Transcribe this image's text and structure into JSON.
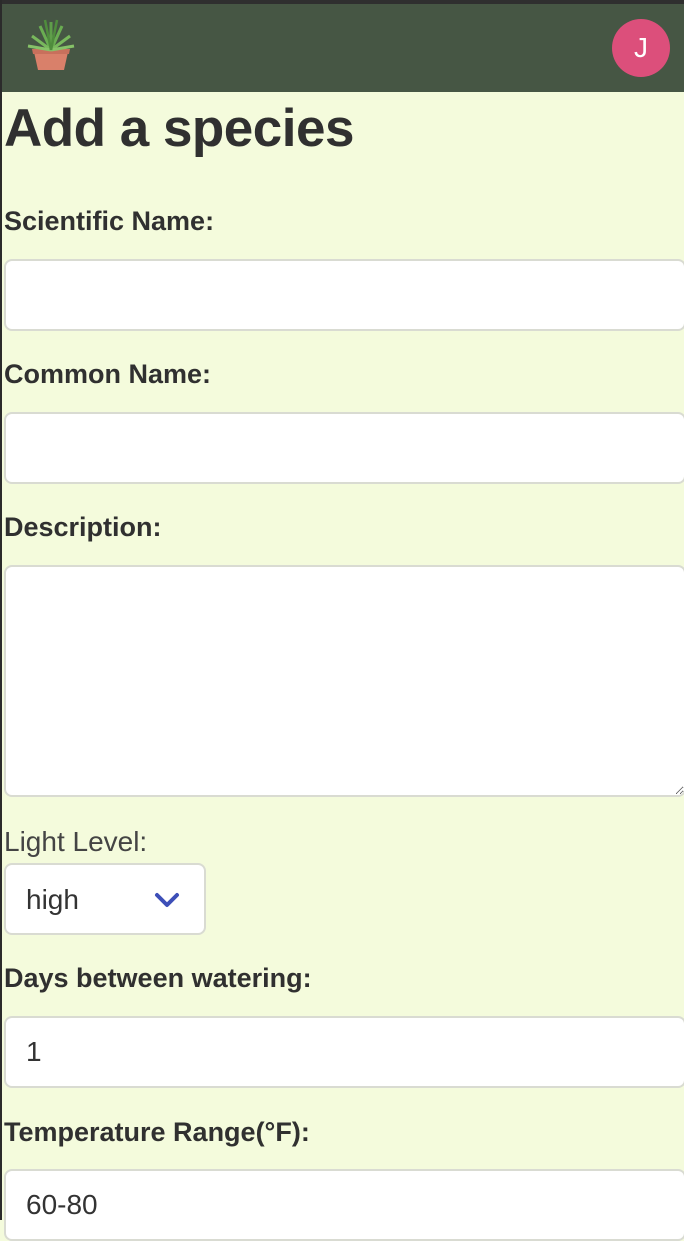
{
  "header": {
    "logo_icon": "potted-plant-icon",
    "avatar_initial": "J",
    "avatar_color": "#dc4f7b",
    "bar_color": "#465644"
  },
  "form": {
    "title": "Add a species",
    "scientific_name": {
      "label": "Scientific Name:",
      "value": ""
    },
    "common_name": {
      "label": "Common Name:",
      "value": ""
    },
    "description": {
      "label": "Description:",
      "value": ""
    },
    "light_level": {
      "label": "Light Level:",
      "selected": "high",
      "icon": "chevron-down-icon"
    },
    "watering": {
      "label": "Days between watering:",
      "value": "1"
    },
    "temperature": {
      "label": "Temperature Range(°F):",
      "value": "60-80"
    }
  },
  "page_background": "#f4fbdc"
}
